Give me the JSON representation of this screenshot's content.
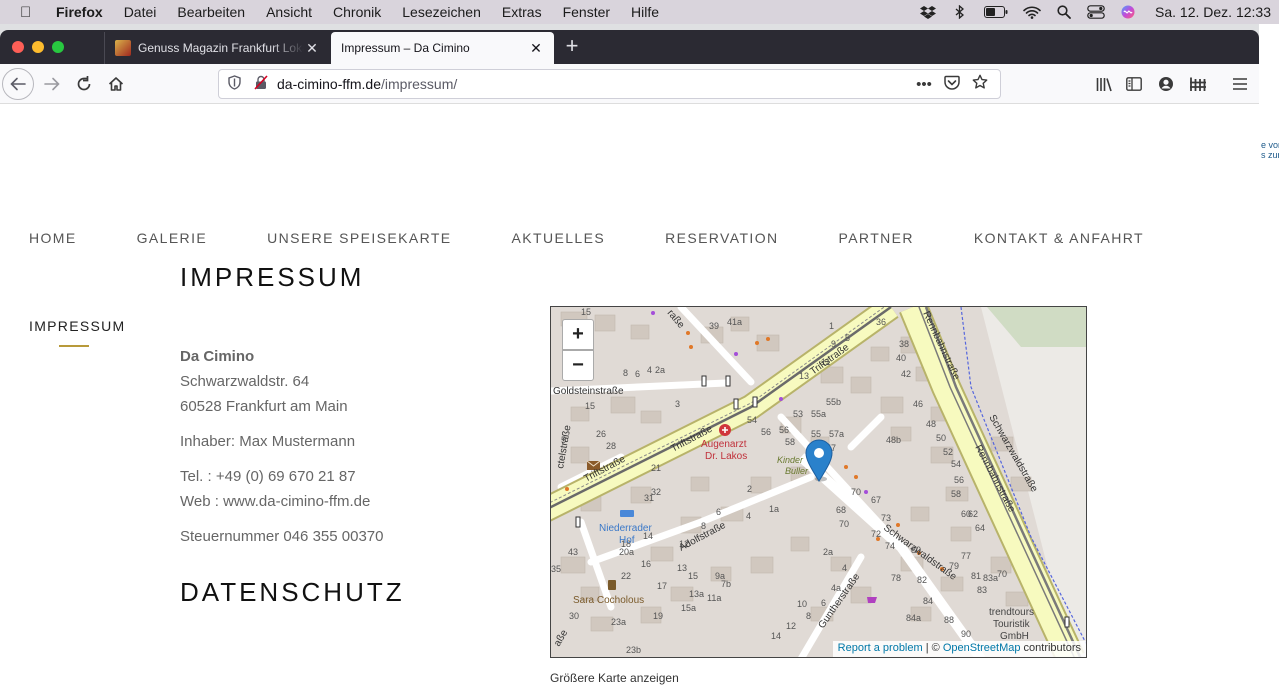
{
  "menubar": {
    "app": "Firefox",
    "items": [
      "Datei",
      "Bearbeiten",
      "Ansicht",
      "Chronik",
      "Lesezeichen",
      "Extras",
      "Fenster",
      "Hilfe"
    ],
    "clock": "Sa. 12. Dez.  12:33"
  },
  "tabs": {
    "inactive_title": "Genuss Magazin Frankfurt Lokal",
    "active_title": "Impressum – Da Cimino"
  },
  "url": {
    "domain": "da-cimino-ffm.de",
    "path": "/impressum/"
  },
  "nav": [
    "HOME",
    "GALERIE",
    "UNSERE SPEISEKARTE",
    "AKTUELLES",
    "RESERVATION",
    "PARTNER",
    "KONTAKT & ANFAHRT"
  ],
  "sidebar": {
    "item": "IMPRESSUM"
  },
  "content": {
    "heading": "IMPRESSUM",
    "company": "Da Cimino",
    "street": "Schwarzwaldstr. 64",
    "city": "60528 Frankfurt am Main",
    "owner": "Inhaber: Max Mustermann",
    "phone": "Tel. : +49 (0) 69 670 21 87",
    "web": "Web : www.da-cimino-ffm.de",
    "tax": "Steuernummer 046 355 00370",
    "heading2": "DATENSCHUTZ"
  },
  "map": {
    "zoom_in": "+",
    "zoom_out": "−",
    "attrib_report": "Report a problem",
    "attrib_sep": " | © ",
    "attrib_osm": "OpenStreetMap",
    "attrib_contrib": " contributors",
    "larger_map": "Größere Karte anzeigen",
    "labels": {
      "triftstrasse1": "Triftstraße",
      "triftstrasse2": "Triftstraße",
      "triftstrasse3": "Triftstraße",
      "goldstein": "Goldsteinstraße",
      "rennbahn1": "Rennbahnstraße",
      "rennbahn2": "Rennbahnstraße",
      "schwarzwald1": "Schwarzwaldstraße",
      "schwarzwald2": "Schwarzwaldstraße",
      "adolf": "Adolfstraße",
      "gunther": "Guntherstraße",
      "augenarzt": "Augenarzt",
      "lakos": "Dr. Lakos",
      "niederrader": "Niederrader",
      "hof": "Hof",
      "sara": "Sara Cocholous",
      "trend1": "trendtours",
      "trend2": "Touristik",
      "trend3": "GmbH",
      "kinder": "Kinder",
      "buller": "Buller"
    }
  },
  "bg_window_text": "e von\ns zur",
  "colors": {
    "tabstrip": "#2b2a33",
    "accent_gold": "#b89a3a",
    "map_road_yellow": "#f7fabf",
    "map_marker": "#2a81cb"
  }
}
